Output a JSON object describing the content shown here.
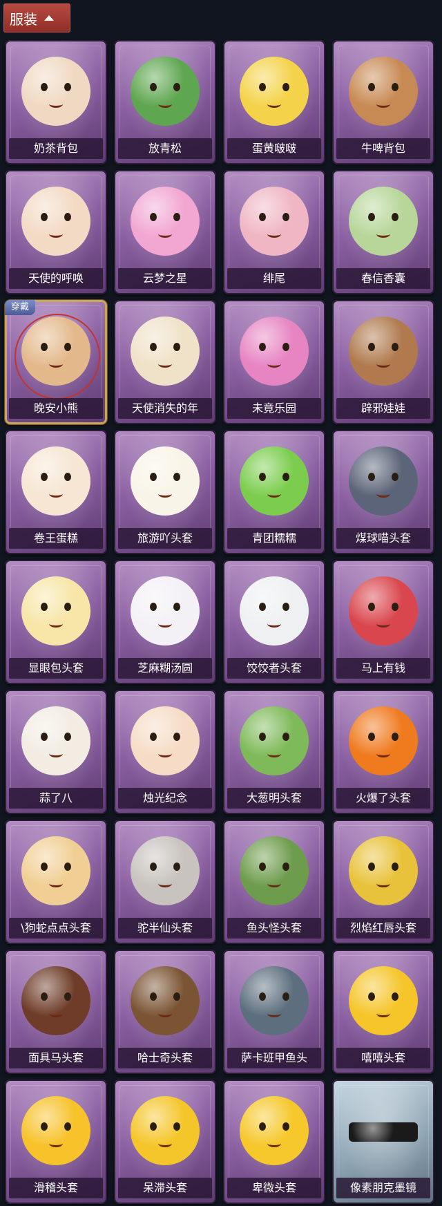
{
  "header": {
    "label": "服装"
  },
  "equipped_badge": "穿戴",
  "items": [
    {
      "label": "奶茶背包",
      "color": "#f0d9c3",
      "state": "normal"
    },
    {
      "label": "放青松",
      "color": "#5fa650",
      "state": "normal"
    },
    {
      "label": "蛋黄啵啵",
      "color": "#f4d34a",
      "state": "normal"
    },
    {
      "label": "牛啤背包",
      "color": "#c88a54",
      "state": "normal"
    },
    {
      "label": "天使的呼唤",
      "color": "#f3dac4",
      "state": "normal"
    },
    {
      "label": "云梦之星",
      "color": "#f2a7d2",
      "state": "normal"
    },
    {
      "label": "绯尾",
      "color": "#f0b6c4",
      "state": "normal"
    },
    {
      "label": "春信香囊",
      "color": "#b8d69a",
      "state": "normal"
    },
    {
      "label": "晚安小熊",
      "color": "#e3b98c",
      "state": "equipped"
    },
    {
      "label": "天使消失的年",
      "color": "#efe2c8",
      "state": "normal"
    },
    {
      "label": "未竟乐园",
      "color": "#e785c3",
      "state": "normal"
    },
    {
      "label": "辟邪娃娃",
      "color": "#b07a4e",
      "state": "normal"
    },
    {
      "label": "卷王蛋糕",
      "color": "#f6e6d3",
      "state": "normal"
    },
    {
      "label": "旅游吖头套",
      "color": "#f9f4e8",
      "state": "normal"
    },
    {
      "label": "青团糯糯",
      "color": "#7ccd4e",
      "state": "normal"
    },
    {
      "label": "煤球喵头套",
      "color": "#5b6478",
      "state": "normal"
    },
    {
      "label": "显眼包头套",
      "color": "#f7e6a7",
      "state": "normal"
    },
    {
      "label": "芝麻糊汤圆",
      "color": "#f4f1f6",
      "state": "normal"
    },
    {
      "label": "饺饺者头套",
      "color": "#eef0f2",
      "state": "normal"
    },
    {
      "label": "马上有钱",
      "color": "#d9464d",
      "state": "normal"
    },
    {
      "label": "蒜了八",
      "color": "#f2ece2",
      "state": "normal"
    },
    {
      "label": "烛光纪念",
      "color": "#f6dcc6",
      "state": "normal"
    },
    {
      "label": "大葱明头套",
      "color": "#7fba5a",
      "state": "normal"
    },
    {
      "label": "火爆了头套",
      "color": "#f07a1e",
      "state": "normal"
    },
    {
      "label": "\\狗蛇点点头套",
      "color": "#f1cf94",
      "state": "normal"
    },
    {
      "label": "驼半仙头套",
      "color": "#c8c3be",
      "state": "normal"
    },
    {
      "label": "鱼头怪头套",
      "color": "#6e9c4d",
      "state": "normal"
    },
    {
      "label": "烈焰红唇头套",
      "color": "#e9c23b",
      "state": "normal"
    },
    {
      "label": "面具马头套",
      "color": "#6e3c28",
      "state": "normal"
    },
    {
      "label": "哈士奇头套",
      "color": "#7b5434",
      "state": "normal"
    },
    {
      "label": "萨卡班甲鱼头",
      "color": "#5d6f7e",
      "state": "normal"
    },
    {
      "label": "嘻嘻头套",
      "color": "#f5c52a",
      "state": "normal"
    },
    {
      "label": "滑稽头套",
      "color": "#f7c22a",
      "state": "normal"
    },
    {
      "label": "呆滞头套",
      "color": "#f5c62a",
      "state": "normal"
    },
    {
      "label": "卑微头套",
      "color": "#f6c82c",
      "state": "normal"
    },
    {
      "label": "像素朋克墨镜",
      "color": "#1a1a1a",
      "state": "gray"
    }
  ]
}
